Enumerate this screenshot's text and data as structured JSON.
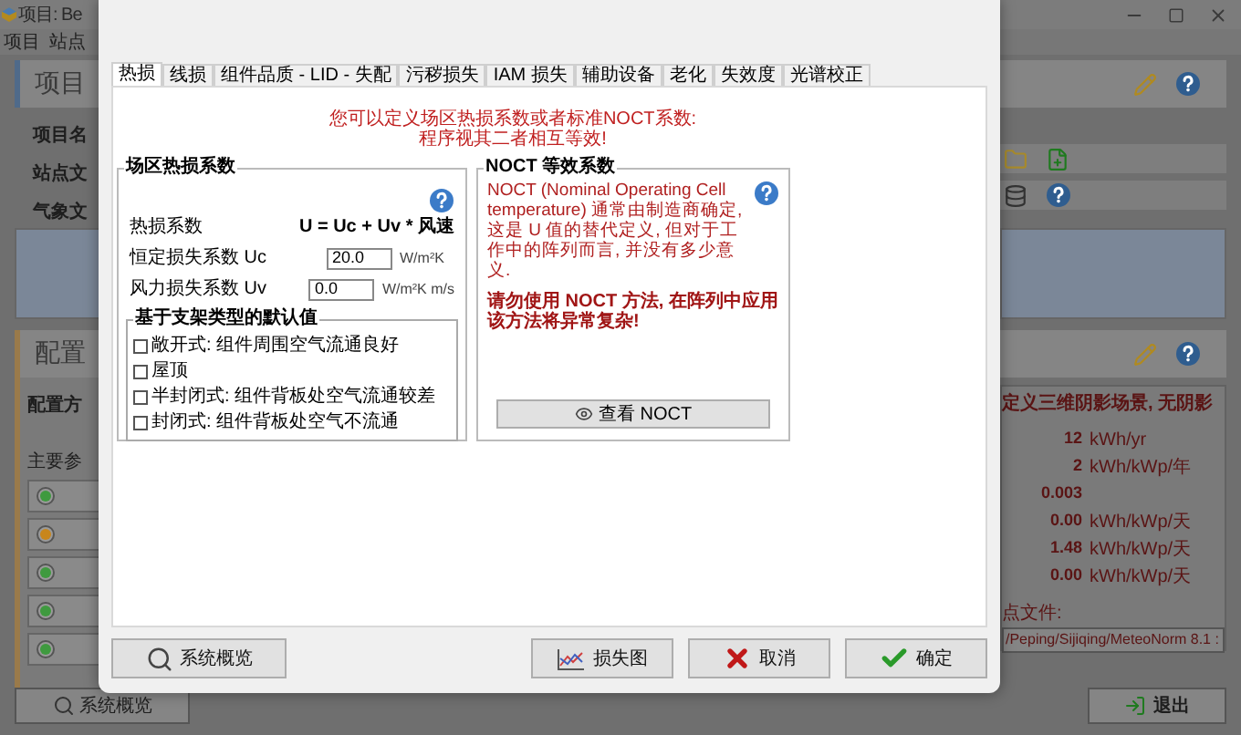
{
  "app": {
    "title": "项目: Be",
    "menu": [
      "项目",
      "站点"
    ],
    "project_panel": {
      "title": "项目",
      "fields": [
        "项目名",
        "站点文",
        "气象文"
      ]
    },
    "config_panel": {
      "title": "配置",
      "label": "配置方",
      "group": "主要参",
      "radios": [
        {
          "color": "#3f9a3f"
        },
        {
          "color": "#c8861c"
        },
        {
          "color": "#3f9a3f"
        },
        {
          "color": "#3f9a3f"
        },
        {
          "color": "#3f9a3f"
        }
      ]
    },
    "results": {
      "headline": "定义三维阴影场景, 无阴影",
      "rows": [
        {
          "value": "12",
          "unit": "kWh/yr"
        },
        {
          "value": "2",
          "unit": "kWh/kWp/年"
        },
        {
          "value": "0.003"
        },
        {
          "value": "0.00",
          "unit": "kWh/kWp/天"
        },
        {
          "value": "1.48",
          "unit": "kWh/kWp/天"
        },
        {
          "value": "0.00",
          "unit": "kWh/kWp/天"
        }
      ],
      "file_label": "点文件:",
      "file_path": "/Peping/Sijiqing/MeteoNorm 8.1 :"
    },
    "overview_button": "系统概览",
    "exit_button": "退出"
  },
  "dialog": {
    "tabs": [
      {
        "label": "热损",
        "selected": true
      },
      {
        "label": "线损",
        "selected": false
      },
      {
        "label": "组件品质 - LID - 失配",
        "selected": false
      },
      {
        "label": "污秽损失",
        "selected": false
      },
      {
        "label": "IAM 损失",
        "selected": false
      },
      {
        "label": "辅助设备",
        "selected": false
      },
      {
        "label": "老化",
        "selected": false
      },
      {
        "label": "失效度",
        "selected": false
      },
      {
        "label": "光谱校正",
        "selected": false
      }
    ],
    "notice": [
      "您可以定义场区热损系数或者标准NOCT系数:",
      "程序视其二者相互等效!"
    ],
    "thermal_group": {
      "title": "场区热损系数",
      "label": "热损系数",
      "formula": "U = Uc + Uv * 风速",
      "fields": [
        {
          "label": "恒定损失系数 Uc",
          "value": "20.0",
          "unit": "W/m²K"
        },
        {
          "label": "风力损失系数 Uv",
          "value": "0.0",
          "unit": "W/m²K m/s"
        }
      ],
      "defaults": {
        "title": "基于支架类型的默认值",
        "options": [
          {
            "label": "敞开式: 组件周围空气流通良好",
            "checked": false
          },
          {
            "label": "屋顶",
            "checked": false
          },
          {
            "label": "半封闭式: 组件背板处空气流通较差",
            "checked": false
          },
          {
            "label": "封闭式: 组件背板处空气不流通",
            "checked": false
          }
        ]
      }
    },
    "noct_group": {
      "title": "NOCT 等效系数",
      "description": "NOCT (Nominal Operating Cell temperature) 通常由制造商确定, 这是 U 值的替代定义, 但对于工作中的阵列而言, 并没有多少意义.",
      "warning": "请勿使用 NOCT 方法, 在阵列中应用该方法将异常复杂!",
      "button": "查看 NOCT"
    },
    "buttons": [
      {
        "kind": "overview",
        "label": "系统概览"
      },
      {
        "kind": "chart",
        "label": "损失图"
      },
      {
        "kind": "cancel",
        "label": "取消"
      },
      {
        "kind": "ok",
        "label": "确定"
      }
    ]
  }
}
